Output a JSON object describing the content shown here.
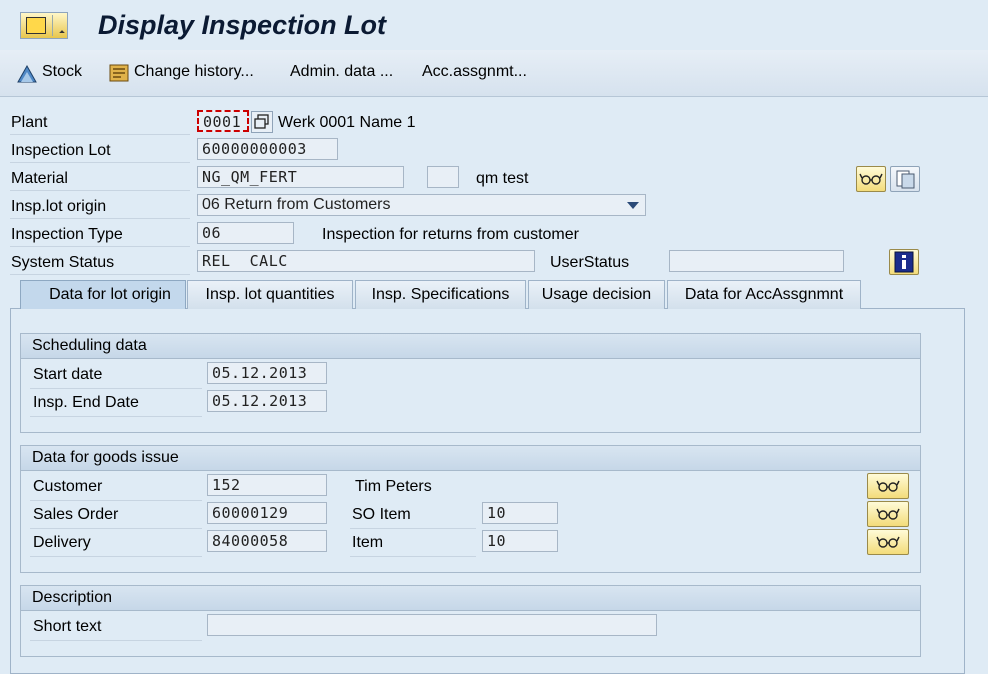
{
  "header": {
    "title": "Display Inspection Lot"
  },
  "toolbar": {
    "stock": "Stock",
    "change_history": "Change history...",
    "admin_data": "Admin. data ...",
    "acc_assgnmt": "Acc.assgnmt..."
  },
  "form": {
    "plant_label": "Plant",
    "plant_value": "0001",
    "plant_desc": "Werk 0001 Name 1",
    "lot_label": "Inspection Lot",
    "lot_value": "60000000003",
    "material_label": "Material",
    "material_value": "NG_QM_FERT",
    "material_desc": "qm test",
    "origin_label": "Insp.lot origin",
    "origin_value": "06 Return from Customers",
    "type_label": "Inspection Type",
    "type_value": "06",
    "type_desc": "Inspection for returns from customer",
    "status_label": "System Status",
    "status_value": "REL  CALC",
    "user_status_label": "UserStatus",
    "user_status_value": ""
  },
  "tabs": [
    {
      "label": "Data for lot origin",
      "active": true
    },
    {
      "label": "Insp. lot quantities",
      "active": false
    },
    {
      "label": "Insp. Specifications",
      "active": false
    },
    {
      "label": "Usage decision",
      "active": false
    },
    {
      "label": "Data for AccAssgnmnt",
      "active": false
    }
  ],
  "scheduling": {
    "title": "Scheduling data",
    "start_label": "Start date",
    "start_value": "05.12.2013",
    "end_label": "Insp. End Date",
    "end_value": "05.12.2013"
  },
  "goods_issue": {
    "title": "Data for goods issue",
    "customer_label": "Customer",
    "customer_value": "152",
    "customer_name": "Tim Peters",
    "sales_order_label": "Sales Order",
    "sales_order_value": "60000129",
    "so_item_label": "SO Item",
    "so_item_value": "10",
    "delivery_label": "Delivery",
    "delivery_value": "84000058",
    "item_label": "Item",
    "item_value": "10"
  },
  "description": {
    "title": "Description",
    "short_text_label": "Short text",
    "short_text_value": ""
  },
  "colors": {
    "background": "#dfebf5",
    "accent": "#0b1a33",
    "focus": "#cc0000"
  }
}
